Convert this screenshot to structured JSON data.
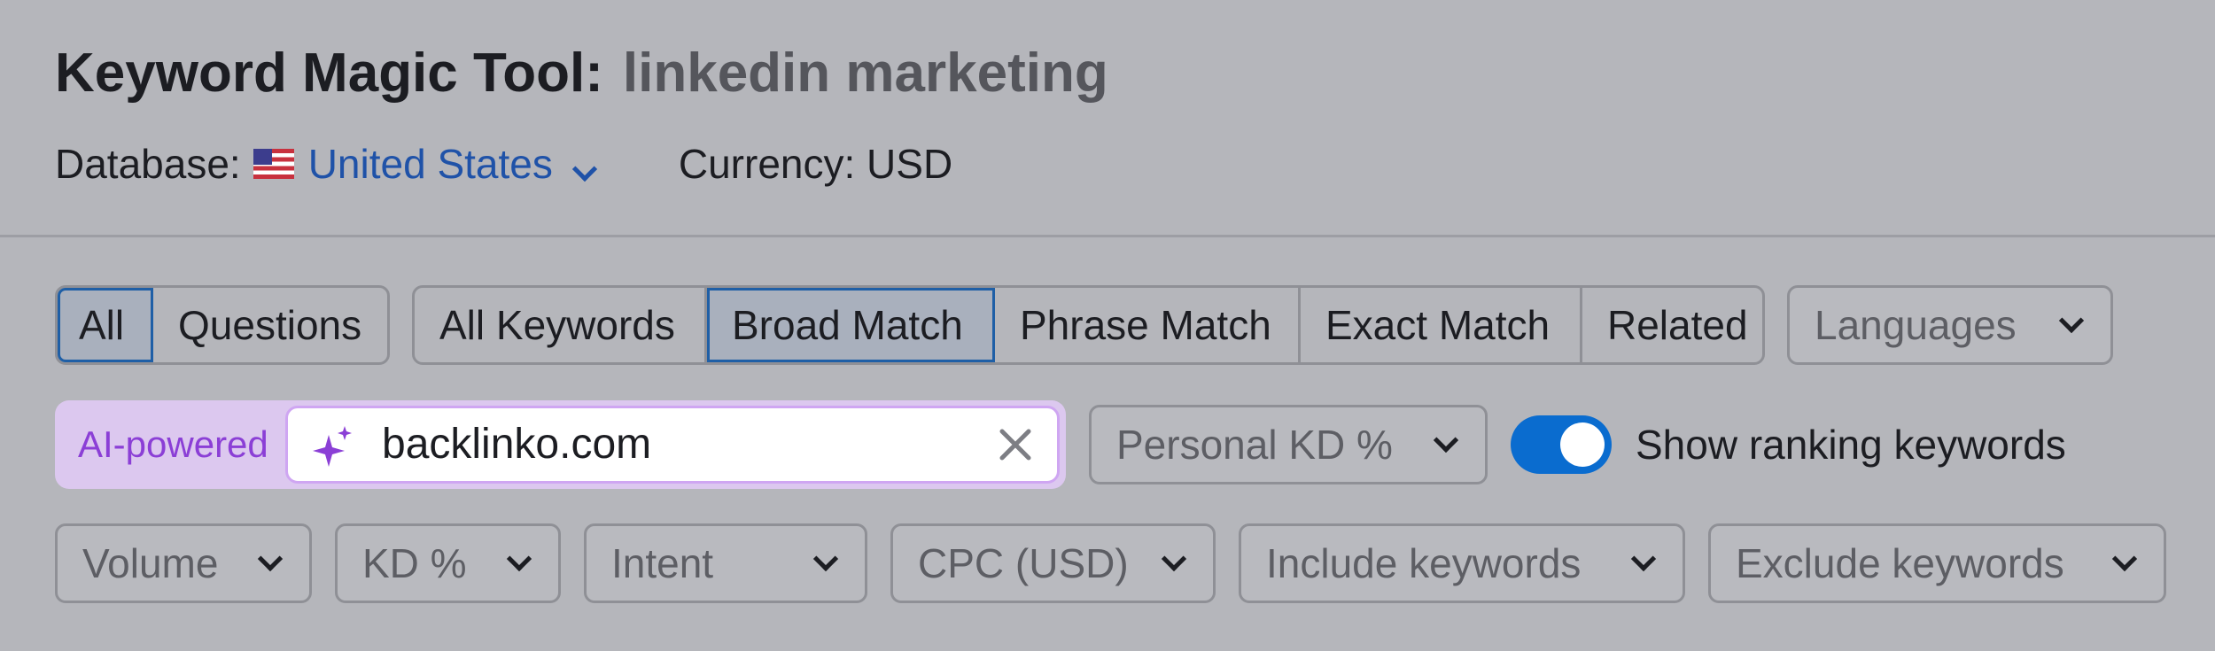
{
  "header": {
    "title": "Keyword Magic Tool:",
    "keyword": "linkedin marketing",
    "database_label": "Database:",
    "database_value": "United States",
    "currency": "Currency: USD"
  },
  "type_tabs": [
    {
      "label": "All",
      "active": true
    },
    {
      "label": "Questions",
      "active": false
    }
  ],
  "match_tabs": [
    {
      "label": "All Keywords",
      "active": false
    },
    {
      "label": "Broad Match",
      "active": true
    },
    {
      "label": "Phrase Match",
      "active": false
    },
    {
      "label": "Exact Match",
      "active": false
    },
    {
      "label": "Related",
      "active": false
    }
  ],
  "languages_dropdown": "Languages",
  "ai": {
    "label": "AI-powered",
    "domain_value": "backlinko.com"
  },
  "personal_kd_dropdown": "Personal KD %",
  "ranking_toggle": {
    "label": "Show ranking keywords",
    "on": true
  },
  "filters": [
    "Volume",
    "KD %",
    "Intent",
    "CPC (USD)",
    "Include keywords",
    "Exclude keywords"
  ],
  "colors": {
    "background": "#b5b6bb",
    "link": "#1f52a8",
    "active_border": "#1f5fa6",
    "ai_accent": "#8b3fd6",
    "toggle": "#0a6ccf"
  },
  "icons": [
    "us-flag-icon",
    "chevron-down-icon",
    "sparkle-icon",
    "close-icon"
  ]
}
